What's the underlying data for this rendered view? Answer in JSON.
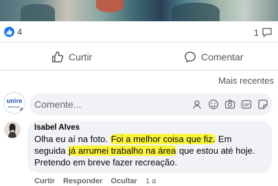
{
  "reactions": {
    "like_count": "4",
    "comment_count": "1"
  },
  "actions": {
    "like_label": "Curtir",
    "comment_label": "Comentar"
  },
  "sort": {
    "label": "Mais recentes"
  },
  "composer": {
    "placeholder": "Comente...",
    "avatar_logo": "unire",
    "avatar_logo_sub": "fisioterapia",
    "tools": [
      "sticker-icon",
      "emoji-icon",
      "camera-icon",
      "gif-icon",
      "sticker-square-icon"
    ]
  },
  "comment": {
    "author": "Isabel Alves",
    "text_parts": {
      "p1": "Olha eu aí na foto. ",
      "h1": "Foi a melhor coisa que fiz.",
      "p2": " Em seguida ",
      "h2": "já arrumei trabalho na área",
      "p3": " que estou até hoje. Pretendo em breve fazer recreação."
    },
    "actions": {
      "like": "Curtir",
      "reply": "Responder",
      "hide": "Ocultar",
      "time": "1 a"
    }
  },
  "colors": {
    "brand_blue": "#1877f2",
    "highlight": "#fbf53a",
    "bubble_bg": "#f0f2f5",
    "muted_text": "#65676b"
  }
}
